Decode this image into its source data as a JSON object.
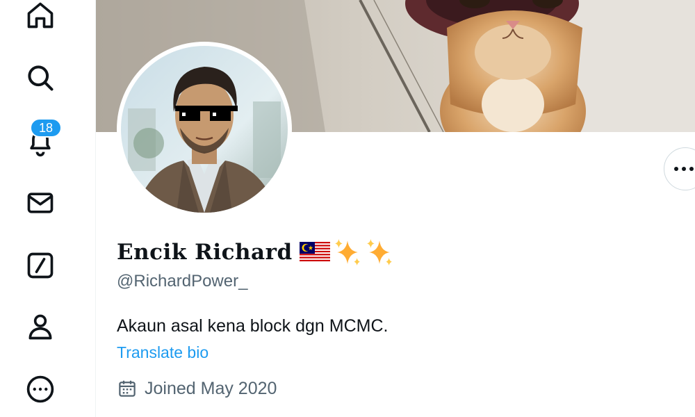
{
  "nav": {
    "items": [
      {
        "name": "home",
        "icon": "home-icon"
      },
      {
        "name": "explore",
        "icon": "search-icon"
      },
      {
        "name": "notifications",
        "icon": "bell-icon",
        "badge": "18"
      },
      {
        "name": "messages",
        "icon": "mail-icon"
      },
      {
        "name": "grok",
        "icon": "slash-square-icon"
      },
      {
        "name": "profile",
        "icon": "person-icon"
      },
      {
        "name": "more",
        "icon": "more-circle-icon"
      }
    ]
  },
  "profile": {
    "display_name": "Encik Richard",
    "name_emojis": [
      "malaysia-flag-icon",
      "sparkles-icon",
      "sparkles-icon"
    ],
    "handle": "@RichardPower_",
    "bio": "Akaun asal kena block dgn MCMC.",
    "translate_label": "Translate bio",
    "joined": "Joined May 2020"
  },
  "colors": {
    "accent": "#1d9bf0",
    "text_primary": "#0f1419",
    "text_secondary": "#536471"
  }
}
